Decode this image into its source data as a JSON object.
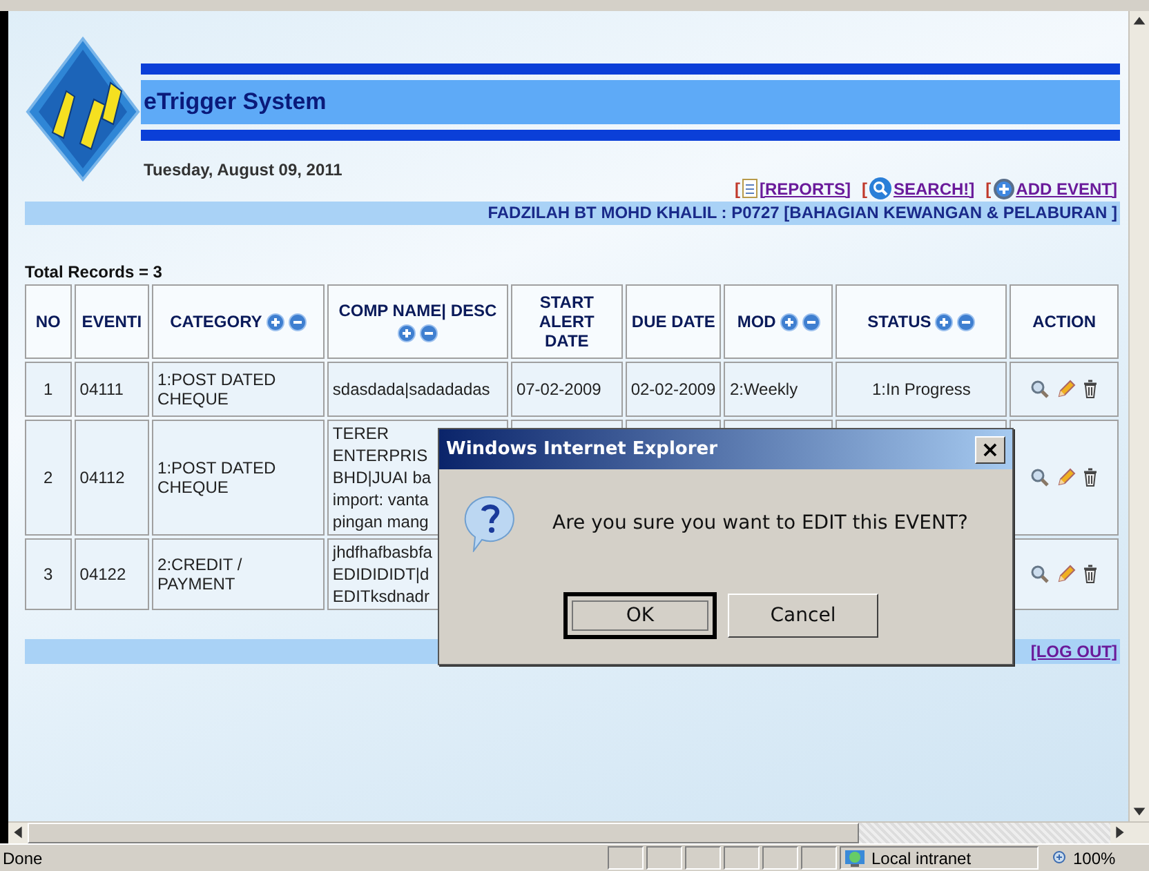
{
  "header": {
    "title": "eTrigger System",
    "date": "Tuesday, August 09, 2011"
  },
  "links": [
    {
      "kind": "reports",
      "prefix": "[",
      "label": "[REPORTS]"
    },
    {
      "kind": "search",
      "prefix": "[",
      "label": "SEARCH!]"
    },
    {
      "kind": "add",
      "prefix": "[",
      "label": "ADD EVENT]"
    }
  ],
  "user_bar": "FADZILAH BT MOHD KHALIL : P0727 [BAHAGIAN KEWANGAN & PELABURAN ]",
  "total": "Total Records = 3",
  "table": {
    "columns": [
      {
        "label": "NO",
        "sortable": false
      },
      {
        "label": "EVENTI",
        "sortable": false
      },
      {
        "label": "CATEGORY",
        "sortable": true
      },
      {
        "label": "COMP NAME| DESC",
        "sortable": true
      },
      {
        "label": "START\nALERT\nDATE",
        "sortable": false
      },
      {
        "label": "DUE DATE",
        "sortable": false
      },
      {
        "label": "MOD",
        "sortable": true
      },
      {
        "label": "STATUS",
        "sortable": true
      },
      {
        "label": "ACTION",
        "sortable": false
      }
    ],
    "rows": [
      {
        "no": "1",
        "event_id": "04111",
        "category": "1:POST DATED\nCHEQUE",
        "comp_desc": "sdasdada|sadadadas",
        "start_alert_date": "07-02-2009",
        "due_date": "02-02-2009",
        "mod": "2:Weekly",
        "status": "1:In Progress"
      },
      {
        "no": "2",
        "event_id": "04112",
        "category": "1:POST DATED\nCHEQUE",
        "comp_desc": "TERER\nENTERPRIS\nBHD|JUAI ba\nimport: vanta\npingan mang"
      },
      {
        "no": "3",
        "event_id": "04122",
        "category": "2:CREDIT /\nPAYMENT",
        "comp_desc": "jhdfhafbasbfa\nEDIDIDIDT|d\nEDITksdnadr"
      }
    ]
  },
  "log_out": "[LOG OUT]",
  "dialog": {
    "title": "Windows Internet Explorer",
    "close": "×",
    "message": "Are you sure you want to EDIT this EVENT?",
    "buttons": [
      {
        "label": "OK",
        "default": true
      },
      {
        "label": "Cancel",
        "default": false
      }
    ]
  },
  "status_bar": {
    "text": "Done",
    "zone": "Local intranet",
    "zoom": "100%"
  }
}
